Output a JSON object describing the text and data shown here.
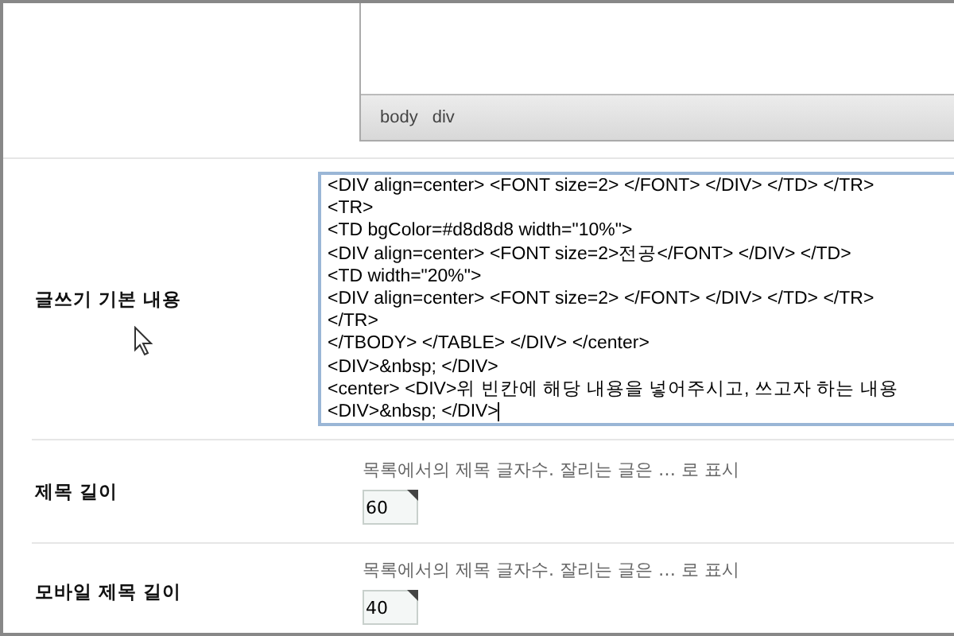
{
  "editor": {
    "path": [
      "body",
      "div"
    ]
  },
  "rows": [
    {
      "kind": "code",
      "label": "글쓰기 기본 내용",
      "lines": [
        "<DIV align=center> <FONT size=2> </FONT> </DIV> </TD> </TR>",
        "<TR>",
        "<TD bgColor=#d8d8d8 width=\"10%\">",
        "<DIV align=center> <FONT size=2>전공</FONT> </DIV> </TD>",
        "<TD width=\"20%\">",
        "<DIV align=center> <FONT size=2> </FONT> </DIV> </TD> </TR>",
        "</TR>",
        "</TBODY> </TABLE> </DIV> </center>",
        "<DIV>&nbsp; </DIV>",
        "<center> <DIV>위 빈칸에 해당 내용을 넣어주시고, 쓰고자 하는 내용",
        "<DIV>&nbsp; </DIV>"
      ]
    },
    {
      "kind": "number",
      "label": "제목 길이",
      "help": "목록에서의 제목 글자수. 잘리는 글은 … 로 표시",
      "value": "60"
    },
    {
      "kind": "number",
      "label": "모바일 제목 길이",
      "help": "목록에서의 제목 글자수. 잘리는 글은 … 로 표시",
      "value": "40"
    }
  ]
}
